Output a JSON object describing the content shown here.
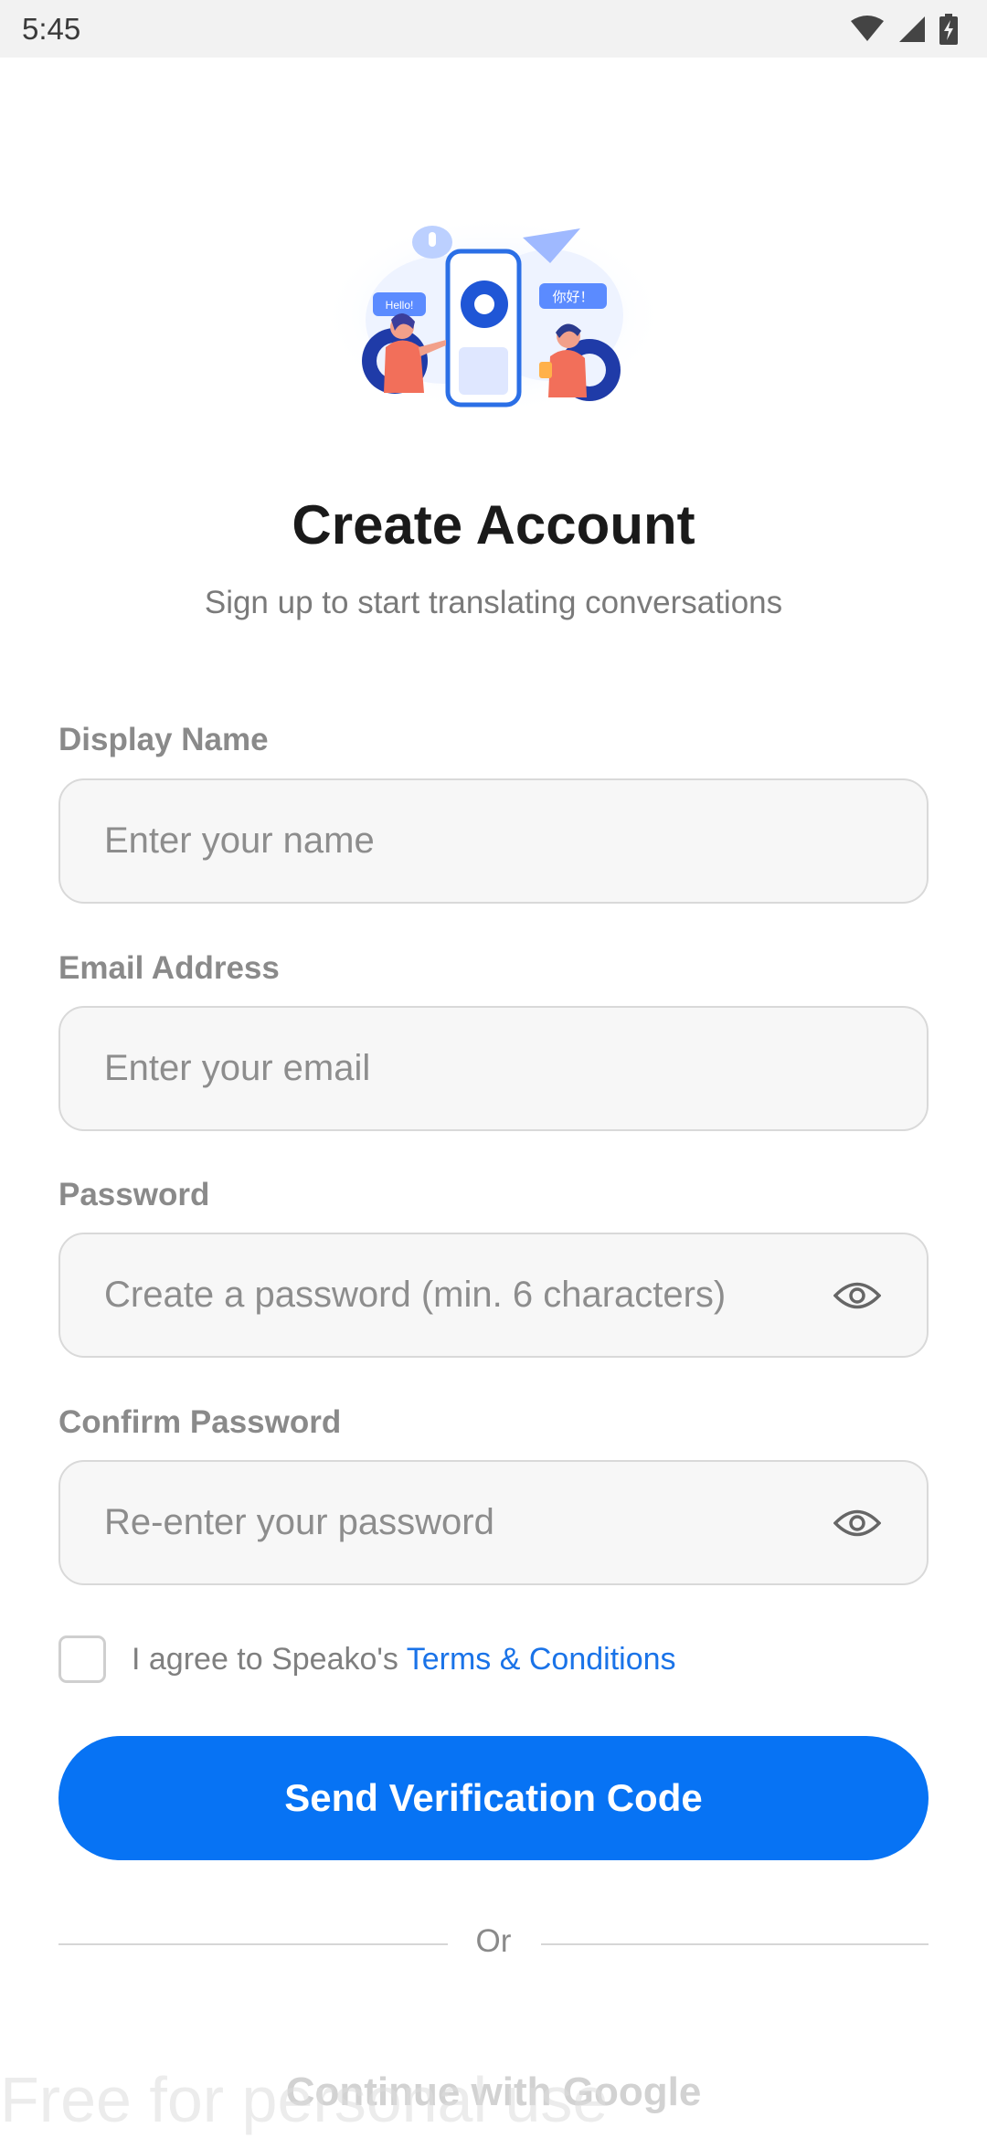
{
  "status_bar": {
    "time": "5:45"
  },
  "header": {
    "title": "Create Account",
    "subtitle": "Sign up to start translating conversations",
    "illustration": {
      "bubble_left": "Hello!",
      "bubble_right": "你好！"
    }
  },
  "form": {
    "display_name": {
      "label": "Display Name",
      "placeholder": "Enter your name",
      "value": ""
    },
    "email": {
      "label": "Email Address",
      "placeholder": "Enter your email",
      "value": ""
    },
    "password": {
      "label": "Password",
      "placeholder": "Create a password (min. 6 characters)",
      "value": ""
    },
    "confirm_password": {
      "label": "Confirm Password",
      "placeholder": "Re-enter your password",
      "value": ""
    },
    "agree": {
      "text": "I agree to Speako's ",
      "link": "Terms & Conditions",
      "checked": false
    },
    "submit_label": "Send Verification Code",
    "divider_text": "Or",
    "google_label": "Continue with Google"
  },
  "watermark": "Free for personal use",
  "colors": {
    "primary": "#0773f4",
    "link": "#1a73e8"
  }
}
